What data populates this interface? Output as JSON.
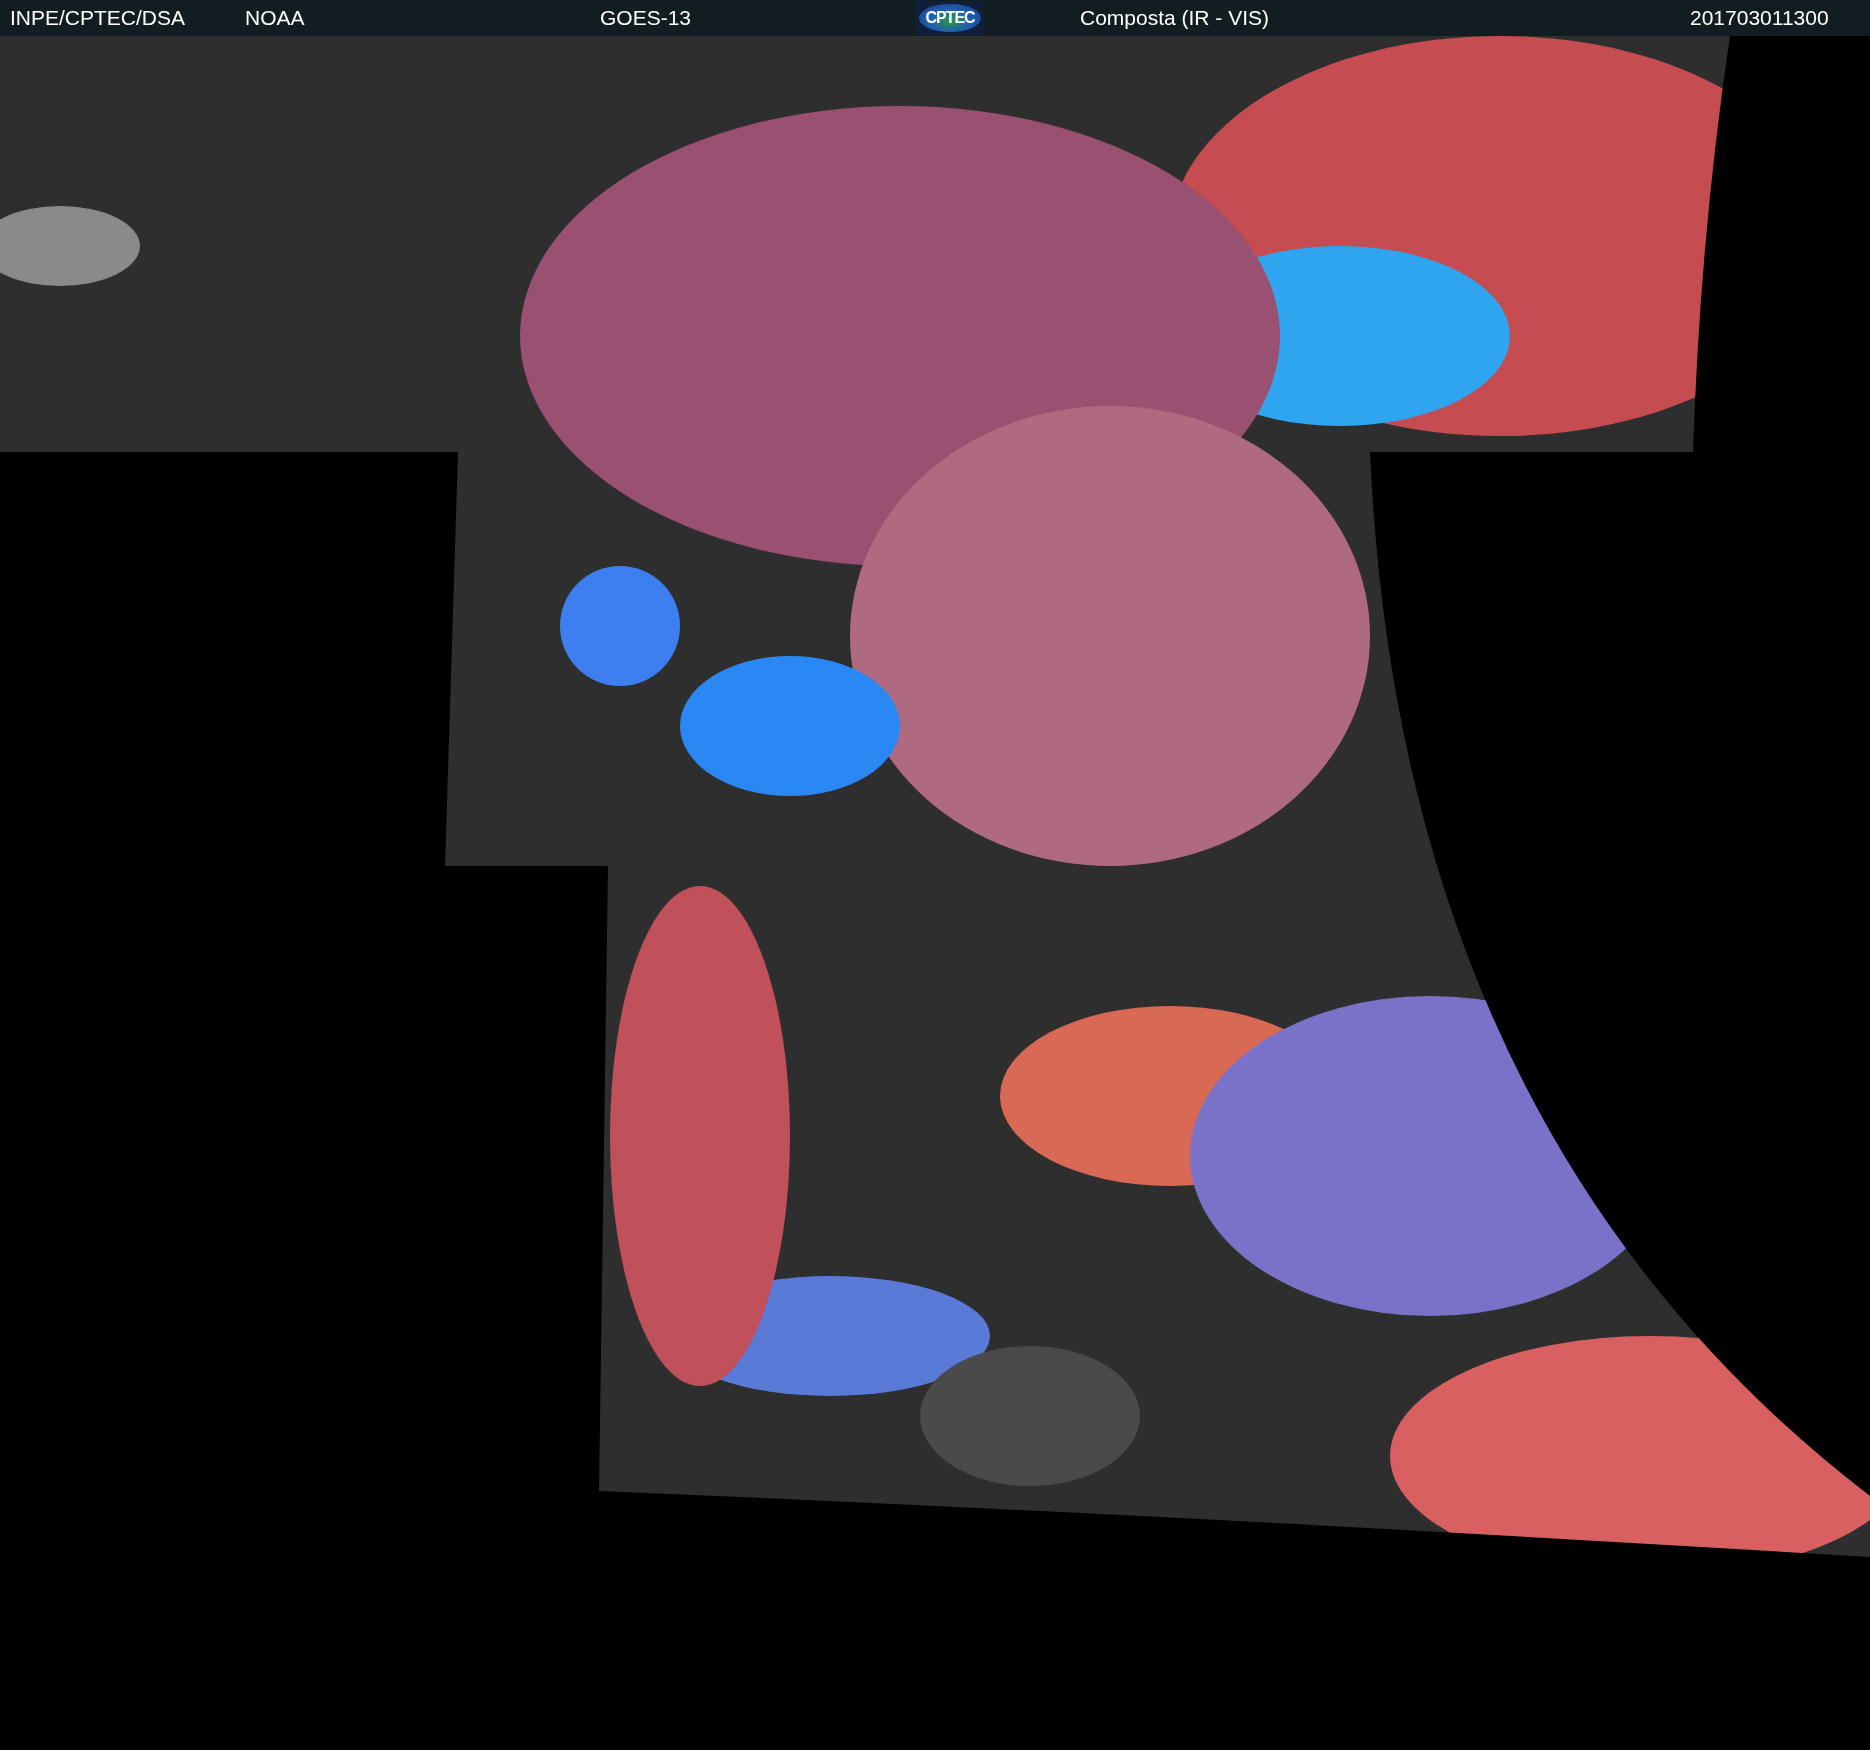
{
  "header": {
    "items": [
      {
        "kind": "text",
        "text": "INPE/CPTEC/DSA"
      },
      {
        "kind": "text",
        "text": "NOAA"
      },
      {
        "kind": "text",
        "text": "GOES-13"
      },
      {
        "kind": "logo",
        "text": "CPTEC"
      },
      {
        "kind": "text",
        "text": "Composta (IR - VIS)"
      },
      {
        "kind": "text",
        "text": "201703011300"
      }
    ]
  }
}
